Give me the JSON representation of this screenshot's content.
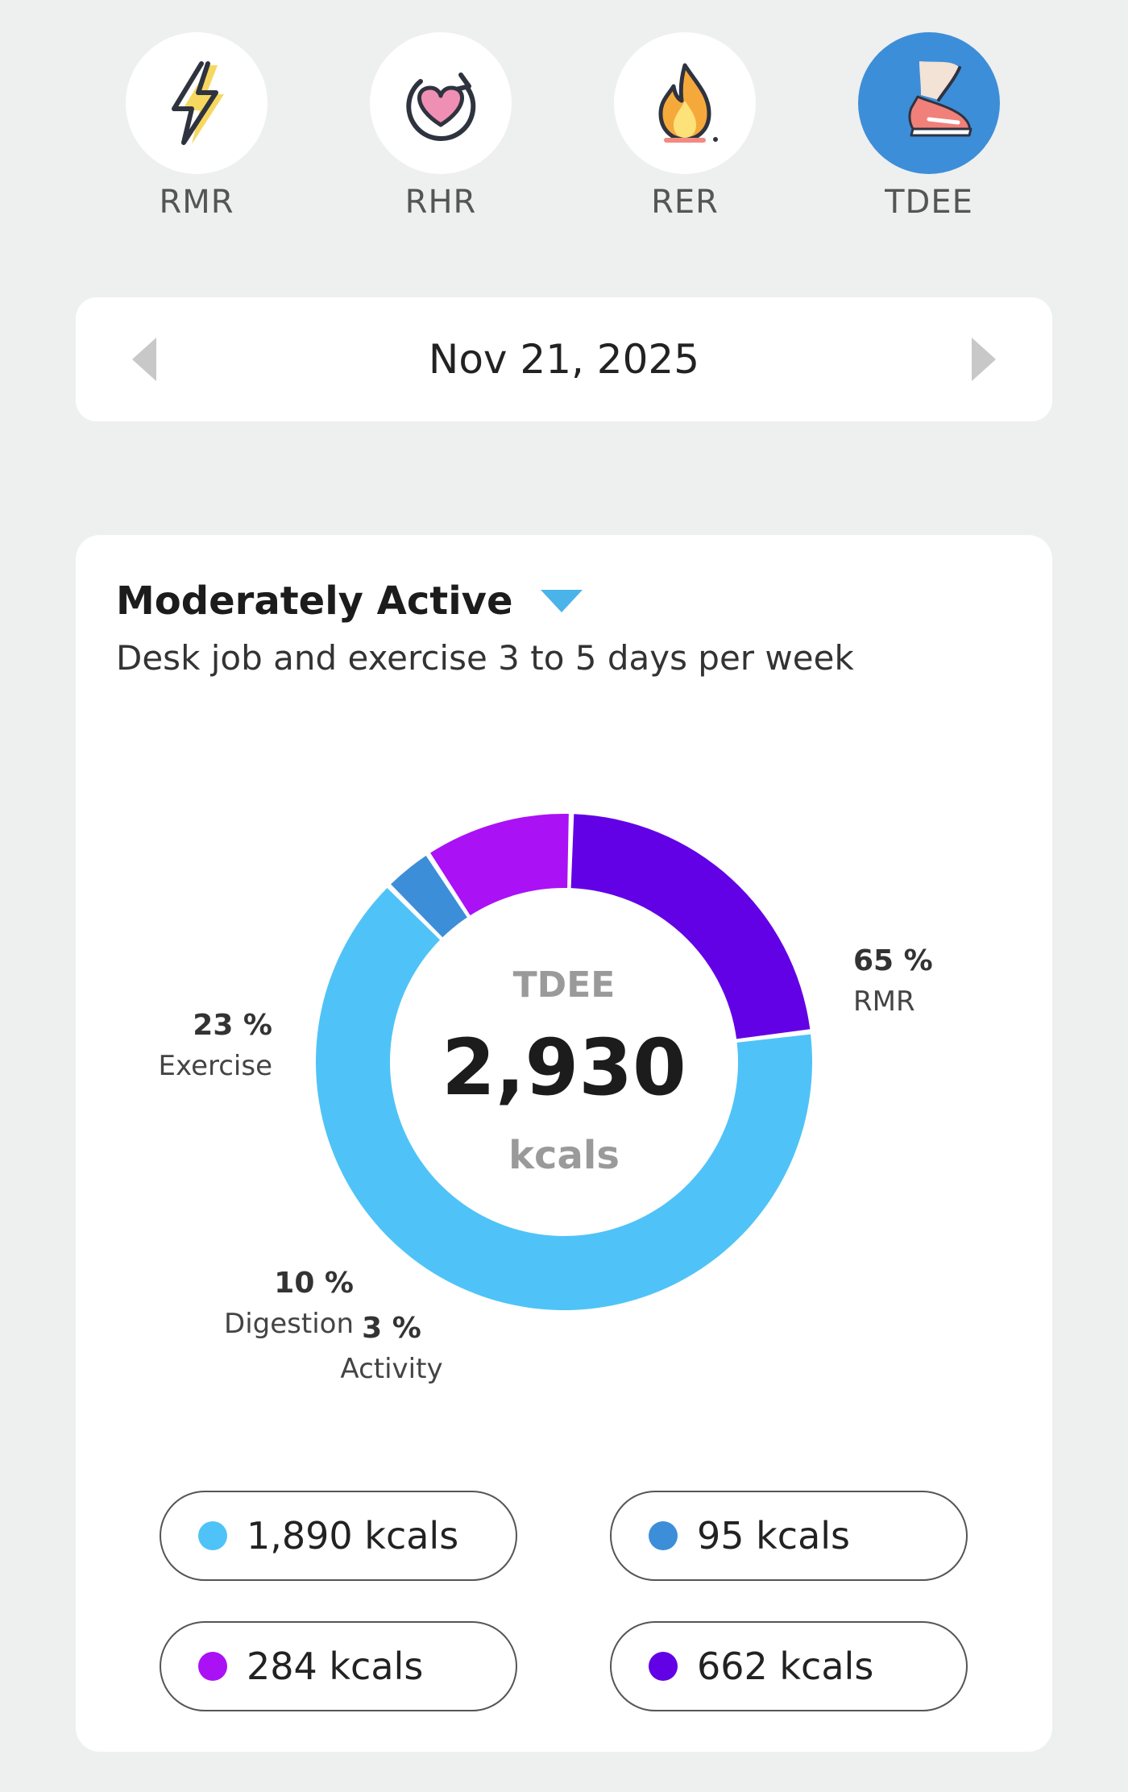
{
  "metrics": [
    {
      "label": "RMR",
      "icon": "lightning-bolt-icon",
      "active": false
    },
    {
      "label": "RHR",
      "icon": "heart-cycle-icon",
      "active": false
    },
    {
      "label": "RER",
      "icon": "flame-icon",
      "active": false
    },
    {
      "label": "TDEE",
      "icon": "running-shoe-icon",
      "active": true
    }
  ],
  "date": {
    "label": "Nov 21, 2025",
    "prev_icon": "chevron-left-icon",
    "next_icon": "chevron-right-icon"
  },
  "activity": {
    "level": "Moderately Active",
    "description": "Desk job and exercise 3 to 5 days per week",
    "caret_icon": "caret-down-icon"
  },
  "center": {
    "title": "TDEE",
    "value": "2,930",
    "unit": "kcals"
  },
  "chart_data": {
    "type": "pie",
    "title": "TDEE",
    "total": 2930,
    "slices": [
      {
        "name": "RMR",
        "percent": 65,
        "pct_label": "65 %",
        "kcal": 1890,
        "color": "#4fc3f7"
      },
      {
        "name": "Activity",
        "percent": 3,
        "pct_label": "3 %",
        "kcal": 95,
        "color": "#3d8ed8"
      },
      {
        "name": "Digestion",
        "percent": 10,
        "pct_label": "10 %",
        "kcal": 284,
        "color": "#aa11f5"
      },
      {
        "name": "Exercise",
        "percent": 23,
        "pct_label": "23 %",
        "kcal": 662,
        "color": "#6200e6"
      }
    ]
  },
  "legend": [
    {
      "value": "1,890 kcals",
      "color": "#4fc3f7"
    },
    {
      "value": "95 kcals",
      "color": "#3d8ed8"
    },
    {
      "value": "284 kcals",
      "color": "#aa11f5"
    },
    {
      "value": "662 kcals",
      "color": "#6200e6"
    }
  ]
}
